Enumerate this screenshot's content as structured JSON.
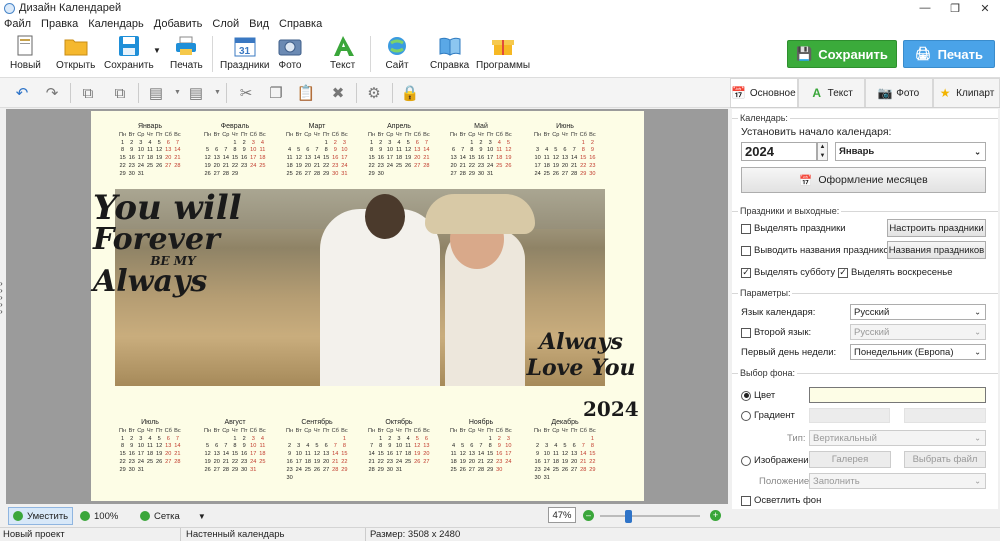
{
  "window": {
    "title": "Дизайн Календарей"
  },
  "menu": [
    "Файл",
    "Правка",
    "Календарь",
    "Добавить",
    "Слой",
    "Вид",
    "Справка"
  ],
  "toolbar": {
    "new": "Новый",
    "open": "Открыть",
    "save": "Сохранить",
    "print": "Печать",
    "holidays": "Праздники",
    "photo": "Фото",
    "text": "Текст",
    "site": "Сайт",
    "help": "Справка",
    "programs": "Программы",
    "save_big": "Сохранить",
    "print_big": "Печать",
    "colors": {
      "save": "#3bab3b",
      "print": "#4aa3e8"
    }
  },
  "calendar": {
    "weekdays": [
      "Пн",
      "Вт",
      "Ср",
      "Чт",
      "Пт",
      "Сб",
      "Вс"
    ],
    "weekend_color": "#c0392b",
    "photo_text_left": [
      "You will",
      "Forever",
      "BE MY",
      "Always"
    ],
    "photo_text_right": [
      "Always",
      "Love You"
    ],
    "year": "2024",
    "months": [
      {
        "name": "Январь",
        "offset": 0,
        "days": 31
      },
      {
        "name": "Февраль",
        "offset": 3,
        "days": 29
      },
      {
        "name": "Март",
        "offset": 4,
        "days": 31
      },
      {
        "name": "Апрель",
        "offset": 0,
        "days": 30
      },
      {
        "name": "Май",
        "offset": 2,
        "days": 31
      },
      {
        "name": "Июнь",
        "offset": 5,
        "days": 30
      },
      {
        "name": "Июль",
        "offset": 0,
        "days": 31
      },
      {
        "name": "Август",
        "offset": 3,
        "days": 31
      },
      {
        "name": "Сентябрь",
        "offset": 6,
        "days": 30
      },
      {
        "name": "Октябрь",
        "offset": 1,
        "days": 31
      },
      {
        "name": "Ноябрь",
        "offset": 4,
        "days": 30
      },
      {
        "name": "Декабрь",
        "offset": 6,
        "days": 31
      }
    ]
  },
  "tabs": [
    "Основное",
    "Текст",
    "Фото",
    "Клипарт"
  ],
  "panel": {
    "calendar_section": "Календарь:",
    "start_label": "Установить начало календаря:",
    "year_value": "2024",
    "month_value": "Январь",
    "month_design_button": "Оформление месяцев",
    "holidays_section": "Праздники и выходные:",
    "highlight_holidays": "Выделять праздники",
    "configure_holidays": "Настроить праздники",
    "show_holiday_names": "Выводить названия праздников",
    "holiday_names_button": "Названия праздников",
    "highlight_saturday": "Выделять субботу",
    "highlight_sunday": "Выделять воскресенье",
    "params_section": "Параметры:",
    "lang_label": "Язык календаря:",
    "lang_value": "Русский",
    "second_lang_label": "Второй язык:",
    "second_lang_value": "Русский",
    "first_day_label": "Первый день недели:",
    "first_day_value": "Понедельник (Европа)",
    "bg_section": "Выбор фона:",
    "color_option": "Цвет",
    "gradient_option": "Градиент",
    "type_label": "Тип:",
    "type_value": "Вертикальный",
    "image_option": "Изображение",
    "gallery_button": "Галерея",
    "choose_file_button": "Выбрать файл",
    "position_label": "Положение:",
    "position_value": "Заполнить",
    "lighten_bg": "Осветлить фон",
    "bg_color": "#fdfde6"
  },
  "bottom": {
    "fit": "Уместить",
    "hundred": "100%",
    "grid": "Сетка",
    "zoom": "47%",
    "zoom_level": 0.47
  },
  "status": {
    "project": "Новый проект",
    "type": "Настенный календарь",
    "size": "Размер: 3508 x 2480"
  }
}
